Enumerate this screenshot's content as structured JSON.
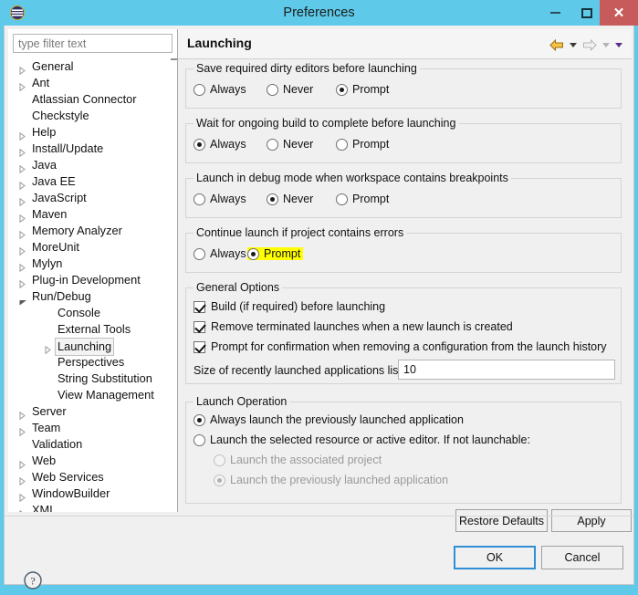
{
  "window": {
    "title": "Preferences",
    "app_icon": "eclipse-icon",
    "minimize_label": "Minimize",
    "maximize_label": "Maximize",
    "close_label": "Close"
  },
  "sidebar": {
    "filter": {
      "value": "",
      "placeholder": "type filter text"
    },
    "items": [
      {
        "label": "General",
        "indent": 0,
        "arrow": "collapsed",
        "selected": false
      },
      {
        "label": "Ant",
        "indent": 0,
        "arrow": "collapsed",
        "selected": false
      },
      {
        "label": "Atlassian Connector",
        "indent": 0,
        "arrow": "none",
        "selected": false
      },
      {
        "label": "Checkstyle",
        "indent": 0,
        "arrow": "none",
        "selected": false
      },
      {
        "label": "Help",
        "indent": 0,
        "arrow": "collapsed",
        "selected": false
      },
      {
        "label": "Install/Update",
        "indent": 0,
        "arrow": "collapsed",
        "selected": false
      },
      {
        "label": "Java",
        "indent": 0,
        "arrow": "collapsed",
        "selected": false
      },
      {
        "label": "Java EE",
        "indent": 0,
        "arrow": "collapsed",
        "selected": false
      },
      {
        "label": "JavaScript",
        "indent": 0,
        "arrow": "collapsed",
        "selected": false
      },
      {
        "label": "Maven",
        "indent": 0,
        "arrow": "collapsed",
        "selected": false
      },
      {
        "label": "Memory Analyzer",
        "indent": 0,
        "arrow": "collapsed",
        "selected": false
      },
      {
        "label": "MoreUnit",
        "indent": 0,
        "arrow": "collapsed",
        "selected": false
      },
      {
        "label": "Mylyn",
        "indent": 0,
        "arrow": "collapsed",
        "selected": false
      },
      {
        "label": "Plug-in Development",
        "indent": 0,
        "arrow": "collapsed",
        "selected": false
      },
      {
        "label": "Run/Debug",
        "indent": 0,
        "arrow": "expanded",
        "selected": false
      },
      {
        "label": "Console",
        "indent": 1,
        "arrow": "none",
        "selected": false
      },
      {
        "label": "External Tools",
        "indent": 1,
        "arrow": "none",
        "selected": false
      },
      {
        "label": "Launching",
        "indent": 1,
        "arrow": "collapsed",
        "selected": true
      },
      {
        "label": "Perspectives",
        "indent": 1,
        "arrow": "none",
        "selected": false
      },
      {
        "label": "String Substitution",
        "indent": 1,
        "arrow": "none",
        "selected": false
      },
      {
        "label": "View Management",
        "indent": 1,
        "arrow": "none",
        "selected": false
      },
      {
        "label": "Server",
        "indent": 0,
        "arrow": "collapsed",
        "selected": false
      },
      {
        "label": "Team",
        "indent": 0,
        "arrow": "collapsed",
        "selected": false
      },
      {
        "label": "Validation",
        "indent": 0,
        "arrow": "none",
        "selected": false
      },
      {
        "label": "Web",
        "indent": 0,
        "arrow": "collapsed",
        "selected": false
      },
      {
        "label": "Web Services",
        "indent": 0,
        "arrow": "collapsed",
        "selected": false
      },
      {
        "label": "WindowBuilder",
        "indent": 0,
        "arrow": "collapsed",
        "selected": false
      },
      {
        "label": "XML",
        "indent": 0,
        "arrow": "collapsed",
        "selected": false
      }
    ]
  },
  "page": {
    "title": "Launching",
    "nav": {
      "back_icon": "back-arrow-icon",
      "back_menu_icon": "chevron-down-icon",
      "forward_icon": "forward-arrow-icon",
      "forward_menu_icon": "chevron-down-icon",
      "view_menu_icon": "chevron-down-icon"
    },
    "groups": [
      {
        "legend": "Save required dirty editors before launching",
        "options": [
          {
            "label": "Always",
            "selected": false
          },
          {
            "label": "Never",
            "selected": false
          },
          {
            "label": "Prompt",
            "selected": true
          }
        ]
      },
      {
        "legend": "Wait for ongoing build to complete before launching",
        "options": [
          {
            "label": "Always",
            "selected": true
          },
          {
            "label": "Never",
            "selected": false
          },
          {
            "label": "Prompt",
            "selected": false
          }
        ]
      },
      {
        "legend": "Launch in debug mode when workspace contains breakpoints",
        "options": [
          {
            "label": "Always",
            "selected": false
          },
          {
            "label": "Never",
            "selected": true
          },
          {
            "label": "Prompt",
            "selected": false
          }
        ]
      },
      {
        "legend": "Continue launch if project contains errors",
        "options": [
          {
            "label": "Always",
            "selected": false,
            "highlighted": false
          },
          {
            "label": "Prompt",
            "selected": true,
            "highlighted": true
          }
        ]
      }
    ],
    "general_options": {
      "legend": "General Options",
      "checkboxes": [
        {
          "label": "Build (if required) before launching",
          "checked": true
        },
        {
          "label": "Remove terminated launches when a new launch is created",
          "checked": true
        },
        {
          "label": "Prompt for confirmation when removing a configuration from the launch history",
          "checked": true
        }
      ],
      "size_label": "Size of recently launched applications list:",
      "size_value": "10"
    },
    "launch_operation": {
      "legend": "Launch Operation",
      "options": [
        {
          "label": "Always launch the previously launched application",
          "selected": true,
          "disabled": false,
          "sub": false
        },
        {
          "label": "Launch the selected resource or active editor. If not launchable:",
          "selected": false,
          "disabled": false,
          "sub": false
        },
        {
          "label": "Launch the associated project",
          "selected": false,
          "disabled": true,
          "sub": true
        },
        {
          "label": "Launch the previously launched application",
          "selected": true,
          "disabled": true,
          "sub": true
        }
      ]
    },
    "restore_defaults_label": "Restore Defaults",
    "apply_label": "Apply"
  },
  "footer": {
    "help_icon": "help-question-icon",
    "ok_label": "OK",
    "cancel_label": "Cancel"
  },
  "colors": {
    "titlebar": "#5ec9e8",
    "close_button": "#c75b5b",
    "highlight": "#ffff00",
    "default_button_border": "#2f8fd4",
    "panel_bg": "#f0f0f0"
  }
}
